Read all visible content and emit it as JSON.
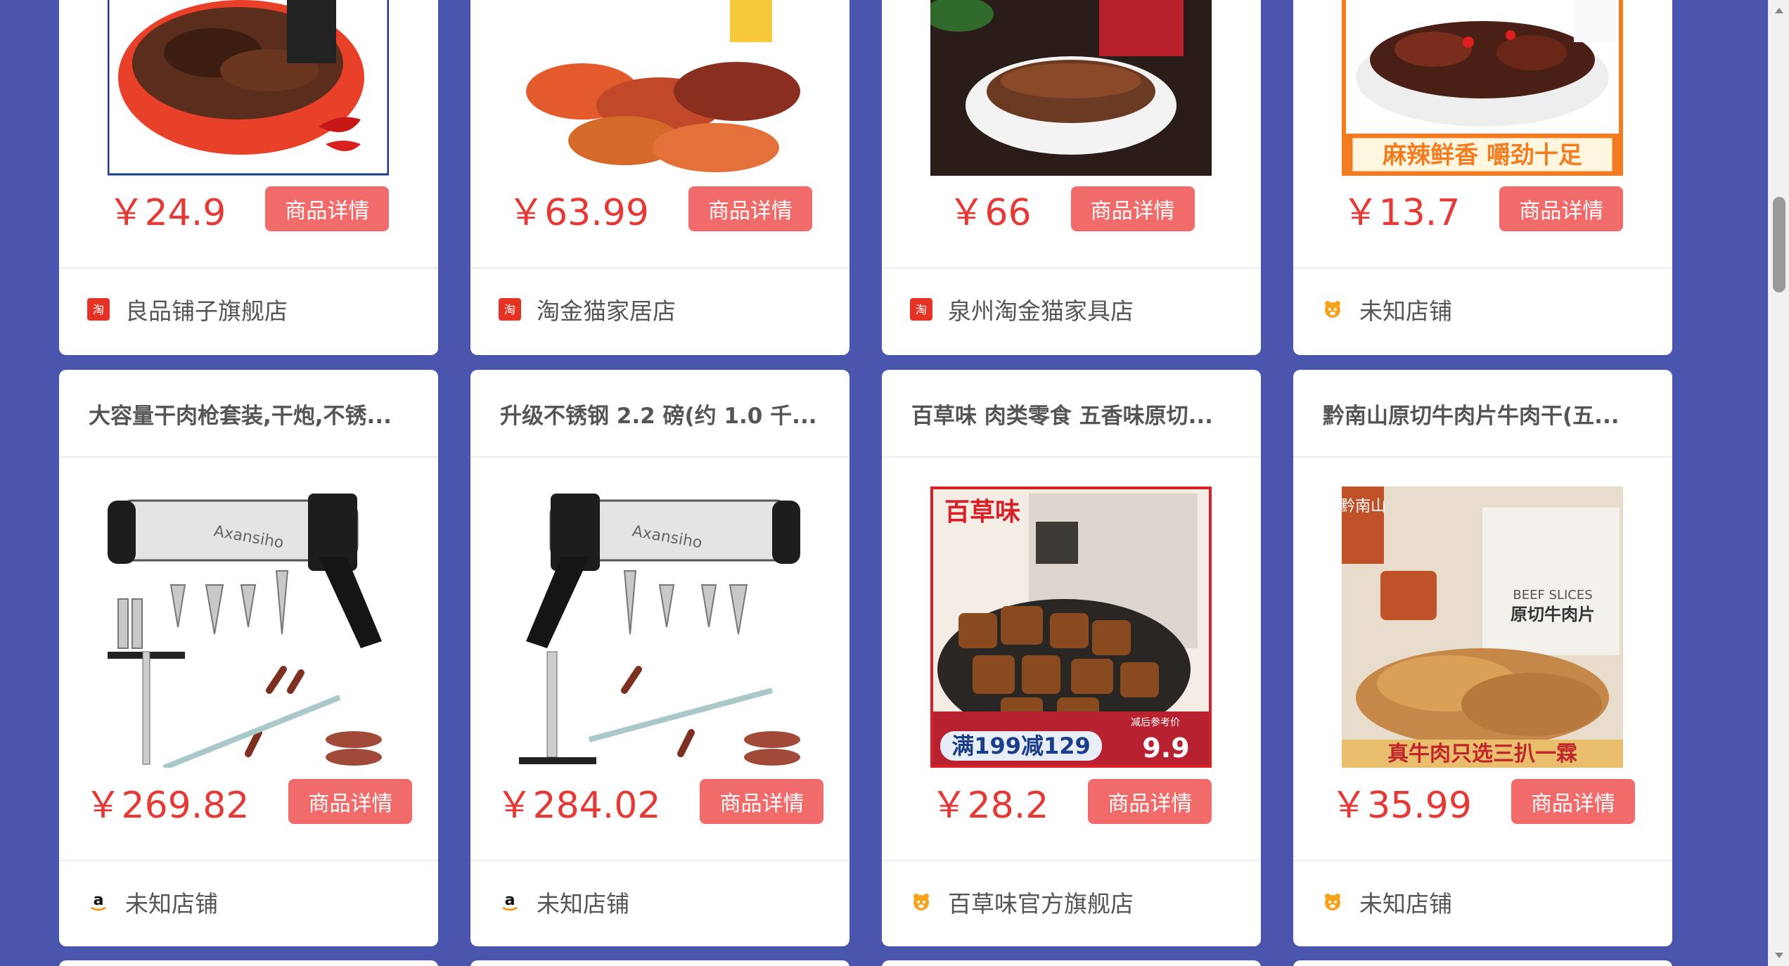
{
  "colors": {
    "background": "#4a56ad",
    "price": "#e53935",
    "button": "#f16b6b",
    "card": "#ffffff"
  },
  "button_label": "商品详情",
  "top_row": [
    {
      "price": "￥24.9",
      "store": "良品铺子旗舰店",
      "store_icon": "taobao-icon"
    },
    {
      "price": "￥63.99",
      "store": "淘金猫家居店",
      "store_icon": "taobao-icon"
    },
    {
      "price": "￥66",
      "store": "泉州淘金猫家具店",
      "store_icon": "taobao-icon"
    },
    {
      "price": "￥13.7",
      "store": "未知店铺",
      "store_icon": "tmall-cat-icon",
      "image_banner": "麻辣鲜香 嚼劲十足"
    }
  ],
  "bottom_row": [
    {
      "title": "大容量干肉枪套装,干炮,不锈...",
      "price": "￥269.82",
      "store": "未知店铺",
      "store_icon": "amazon-icon",
      "image_text": "Axansiho"
    },
    {
      "title": "升级不锈钢 2.2 磅(约 1.0 千...",
      "price": "￥284.02",
      "store": "未知店铺",
      "store_icon": "amazon-icon",
      "image_text": "Axansiho"
    },
    {
      "title": "百草味 肉类零食 五香味原切...",
      "price": "￥28.2",
      "store": "百草味官方旗舰店",
      "store_icon": "tmall-cat-icon",
      "image_text": {
        "brand": "百草味",
        "promo": "满199减129",
        "promo_price": "9.9",
        "promo_label": "减后参考价"
      }
    },
    {
      "title": "黔南山原切牛肉片牛肉干(五...",
      "price": "￥35.99",
      "store": "未知店铺",
      "store_icon": "tmall-cat-icon",
      "image_text": {
        "brand": "黔南山",
        "subtitle": "BEEF SLICES",
        "product": "原切牛肉片",
        "banner": "真牛肉只选三扒一霖"
      }
    }
  ]
}
